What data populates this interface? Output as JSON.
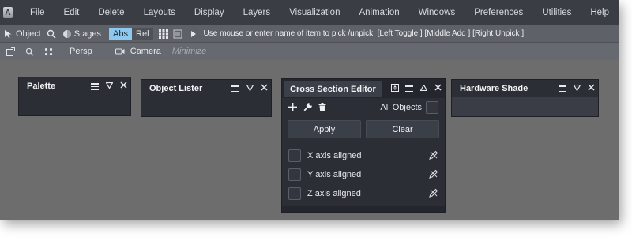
{
  "app": {
    "logo_letter": "A"
  },
  "menu": {
    "items": [
      "File",
      "Edit",
      "Delete",
      "Layouts",
      "Display",
      "Layers",
      "Visualization",
      "Animation",
      "Windows",
      "Preferences",
      "Utilities",
      "Help"
    ]
  },
  "toolbar": {
    "object_label": "Object",
    "stages_label": "Stages",
    "abs_label": "Abs",
    "rel_label": "Rel",
    "hint": "Use mouse or enter name of item to pick /unpick: [Left Toggle ] [Middle Add ] [Right Unpick ]"
  },
  "viewbar": {
    "persp_label": "Persp",
    "camera_label": "Camera",
    "minimize_label": "Minimize"
  },
  "panels": {
    "palette": {
      "title": "Palette"
    },
    "object_lister": {
      "title": "Object Lister"
    },
    "hardware_shade": {
      "title": "Hardware Shade"
    },
    "cross_section": {
      "title": "Cross Section Editor",
      "all_objects_label": "All Objects",
      "apply_label": "Apply",
      "clear_label": "Clear",
      "axes": [
        "X axis aligned",
        "Y axis aligned",
        "Z axis aligned"
      ]
    }
  },
  "colors": {
    "accent": "#8cc8ef",
    "panel_bg": "#2b2e35",
    "workspace_bg": "#6d6d6d"
  }
}
